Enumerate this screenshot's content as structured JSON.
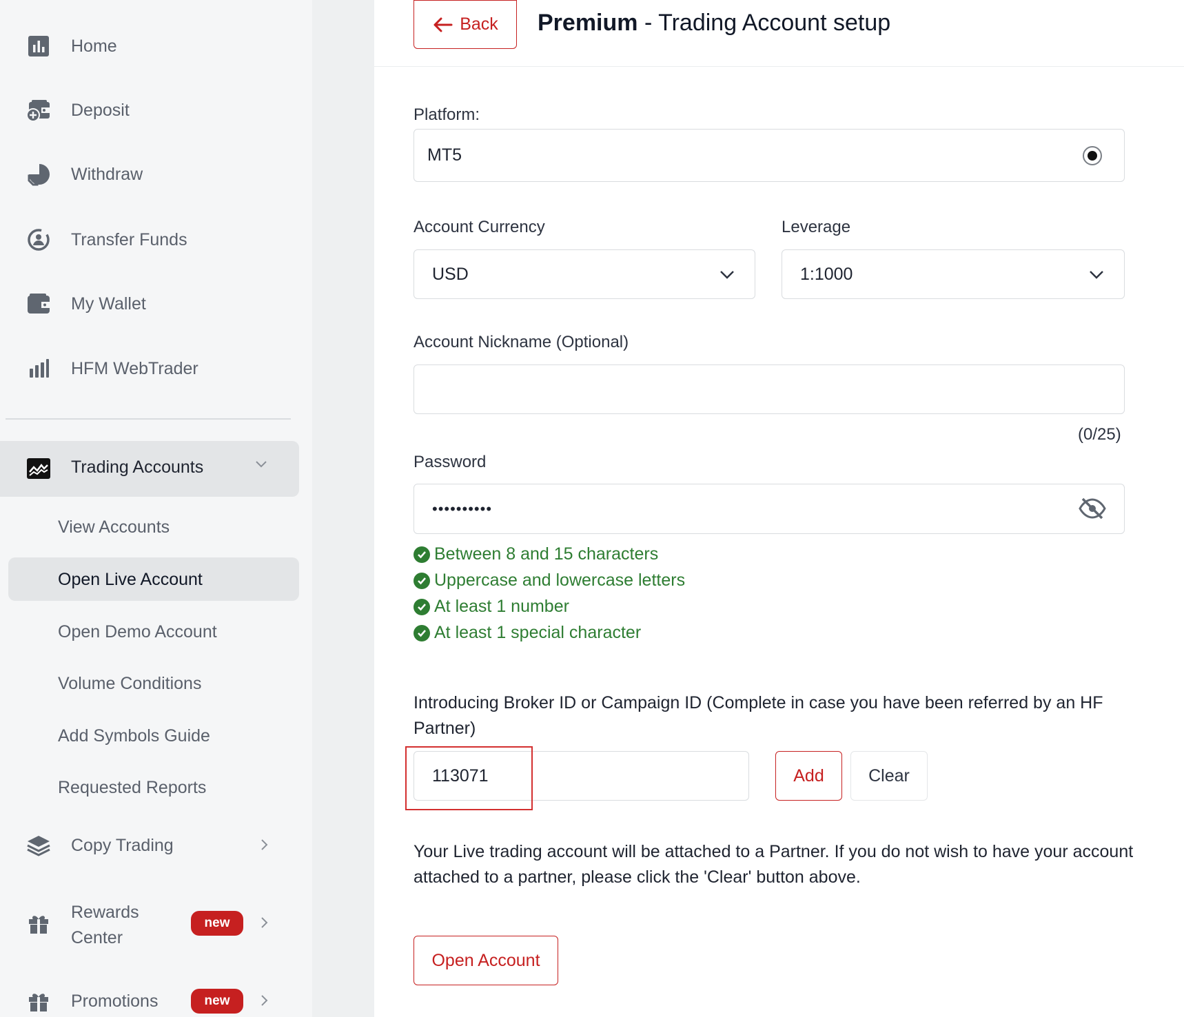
{
  "sidebar": {
    "items": [
      {
        "label": "Home",
        "icon": "chart-square-icon"
      },
      {
        "label": "Deposit",
        "icon": "wallet-plus-icon"
      },
      {
        "label": "Withdraw",
        "icon": "pie-chart-icon"
      },
      {
        "label": "Transfer Funds",
        "icon": "transfer-icon"
      },
      {
        "label": "My Wallet",
        "icon": "wallet-icon"
      },
      {
        "label": "HFM WebTrader",
        "icon": "bar-chart-icon"
      }
    ],
    "trading_accounts": {
      "label": "Trading Accounts",
      "icon": "trading-chart-icon",
      "sub_items": [
        "View Accounts",
        "Open Live Account",
        "Open Demo Account",
        "Volume Conditions",
        "Add Symbols Guide",
        "Requested Reports"
      ],
      "active_sub": "Open Live Account"
    },
    "copy_trading": {
      "label": "Copy Trading",
      "icon": "layers-icon"
    },
    "rewards": {
      "label_line1": "Rewards",
      "label_line2": "Center",
      "badge": "new",
      "icon": "gift-icon"
    },
    "promotions": {
      "label": "Promotions",
      "badge": "new",
      "icon": "gift-icon"
    }
  },
  "header": {
    "back_label": "Back",
    "title_bold": "Premium",
    "title_rest": " - Trading Account setup"
  },
  "form": {
    "platform_label": "Platform:",
    "platform_value": "MT5",
    "currency_label": "Account Currency",
    "currency_value": "USD",
    "leverage_label": "Leverage",
    "leverage_value": "1:1000",
    "nickname_label": "Account Nickname (Optional)",
    "nickname_value": "",
    "nickname_counter": "(0/25)",
    "password_label": "Password",
    "password_value": "••••••••••",
    "password_rules": [
      "Between 8 and 15 characters",
      "Uppercase and lowercase letters",
      "At least 1 number",
      "At least 1 special character"
    ],
    "ib_label": "Introducing Broker ID or Campaign ID (Complete in case you have been referred by an HF Partner)",
    "ib_value": "113071",
    "add_label": "Add",
    "clear_label": "Clear",
    "partner_note": "Your Live trading account will be attached to a Partner. If you do not wish to have your account attached to a partner, please click the 'Clear' button above.",
    "submit_label": "Open Account"
  },
  "colors": {
    "accent": "#c62020",
    "success": "#2e7d32"
  }
}
